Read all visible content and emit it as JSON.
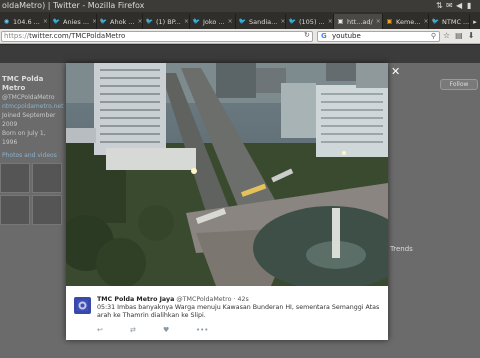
{
  "window": {
    "title": "oldaMetro) | Twitter - Mozilla Firefox"
  },
  "tabs": [
    {
      "label": "104.6 ...",
      "icon": "radio-icon"
    },
    {
      "label": "Anies ...",
      "icon": "twitter-icon"
    },
    {
      "label": "Ahok ...",
      "icon": "twitter-icon"
    },
    {
      "label": "(1) BP...",
      "icon": "twitter-icon"
    },
    {
      "label": "Joko ...",
      "icon": "twitter-icon"
    },
    {
      "label": "Sandia...",
      "icon": "twitter-icon"
    },
    {
      "label": "(105) ...",
      "icon": "twitter-icon"
    },
    {
      "label": "htt...ad/",
      "icon": "page-icon"
    },
    {
      "label": "Keme...",
      "icon": "page-icon"
    },
    {
      "label": "NTMC ...",
      "icon": "twitter-icon"
    }
  ],
  "nav": {
    "url_prefix": "https://",
    "url_rest": "twitter.com/TMCPoldaMetro",
    "search_value": "youtube"
  },
  "background": {
    "profile_name": "TMC Polda Metro",
    "profile_handle": "@TMCPoldaMetro",
    "profile_link": "ntmcpoldametro.net",
    "profile_joined": "Joined September 2009",
    "profile_born": "Born on July 1, 1996",
    "profile_misc": "Photos and videos",
    "right_follow": "Follow",
    "right_trends": "Trends"
  },
  "tweet": {
    "author": "TMC Polda Metro Jaya",
    "handle": "@TMCPoldaMetro",
    "time": "· 42s",
    "text": "05:31 Imbas banyaknya Warga menuju Kawasan Bunderan HI, sementara Semanggi Atas arah ke Thamrin dialihkan ke Slipi.",
    "actions": [
      "reply-icon",
      "retweet-icon",
      "like-icon",
      "more-icon"
    ]
  }
}
